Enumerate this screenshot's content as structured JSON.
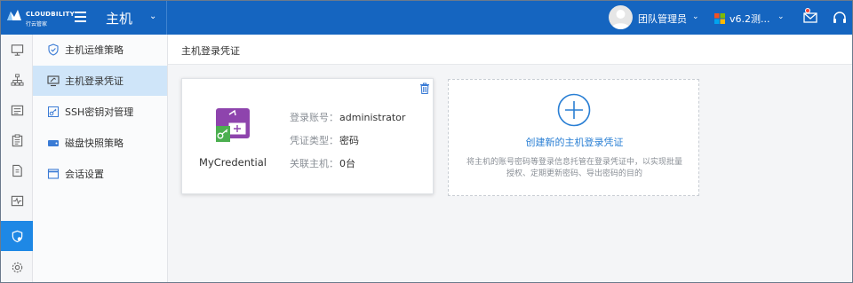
{
  "brand": {
    "name": "CLOUDBILITY",
    "sub": "行云管家"
  },
  "header": {
    "module": "主机",
    "user": "团队管理员",
    "version": "v6.2测...",
    "colors": {
      "bar": "#1565c0",
      "notification": "#f44336"
    }
  },
  "rail": [
    "monitor-icon",
    "topology-icon",
    "list-icon",
    "clipboard-icon",
    "document-icon",
    "activity-icon",
    "shield-icon",
    "gear-icon"
  ],
  "subnav": {
    "items": [
      {
        "label": "主机运维策略",
        "icon": "shield-check-icon"
      },
      {
        "label": "主机登录凭证",
        "icon": "monitor-key-icon"
      },
      {
        "label": "SSH密钥对管理",
        "icon": "key-icon"
      },
      {
        "label": "磁盘快照策略",
        "icon": "disk-snapshot-icon"
      },
      {
        "label": "会话设置",
        "icon": "window-icon"
      }
    ]
  },
  "breadcrumb": "主机登录凭证",
  "credential": {
    "name": "MyCredential",
    "fields": [
      {
        "label": "登录账号：",
        "value": "administrator"
      },
      {
        "label": "凭证类型：",
        "value": "密码"
      },
      {
        "label": "关联主机：",
        "value": "0台"
      }
    ]
  },
  "create": {
    "title": "创建新的主机登录凭证",
    "description": "将主机的账号密码等登录信息托管在登录凭证中，以实现批量授权、定期更新密码、导出密码的目的"
  }
}
